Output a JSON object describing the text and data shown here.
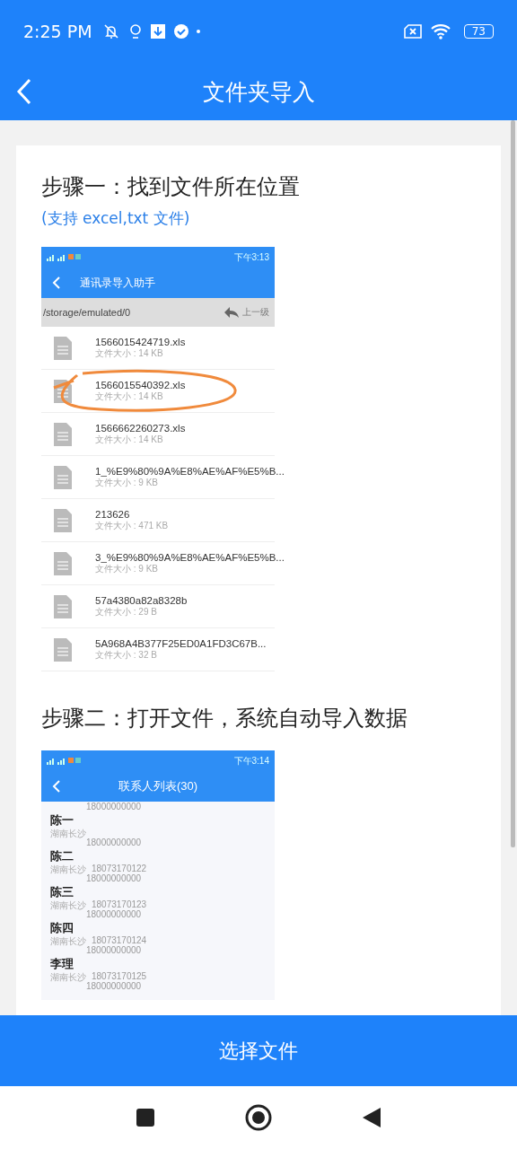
{
  "status_bar": {
    "time": "2:25 PM",
    "battery": "73"
  },
  "header": {
    "title": "文件夹导入"
  },
  "steps": [
    {
      "title": "步骤一：找到文件所在位置",
      "hint": "(支持 excel,txt 文件)",
      "kind": "files",
      "screen": {
        "status_time": "下午3:13",
        "title": "通讯录导入助手",
        "path": "/storage/emulated/0",
        "up_label": "上一级",
        "files": [
          {
            "name": "1566015424719.xls",
            "size": "文件大小 : 14 KB",
            "circled": false
          },
          {
            "name": "1566015540392.xls",
            "size": "文件大小 : 14 KB",
            "circled": true
          },
          {
            "name": "1566662260273.xls",
            "size": "文件大小 : 14 KB",
            "circled": false
          },
          {
            "name": "1_%E9%80%9A%E8%AE%AF%E5%B...",
            "size": "文件大小 : 9 KB",
            "circled": false
          },
          {
            "name": "213626",
            "size": "文件大小 : 471 KB",
            "circled": false
          },
          {
            "name": "3_%E9%80%9A%E8%AE%AF%E5%B...",
            "size": "文件大小 : 9 KB",
            "circled": false
          },
          {
            "name": "57a4380a82a8328b",
            "size": "文件大小 : 29 B",
            "circled": false
          },
          {
            "name": "5A968A4B377F25ED0A1FD3C67B...",
            "size": "文件大小 : 32 B",
            "circled": false
          }
        ]
      }
    },
    {
      "title": "步骤二：打开文件，系统自动导入数据",
      "kind": "contacts",
      "screen": {
        "status_time": "下午3:14",
        "title": "联系人列表(30)",
        "top_partial": "18000000000",
        "contacts": [
          {
            "name": "陈一",
            "city": "湖南长沙",
            "phone2": "18000000000"
          },
          {
            "name": "陈二",
            "city": "湖南长沙",
            "phone": "18073170122",
            "phone2": "18000000000"
          },
          {
            "name": "陈三",
            "city": "湖南长沙",
            "phone": "18073170123",
            "phone2": "18000000000"
          },
          {
            "name": "陈四",
            "city": "湖南长沙",
            "phone": "18073170124",
            "phone2": "18000000000"
          },
          {
            "name": "李理",
            "city": "湖南长沙",
            "phone": "18073170125",
            "phone2": "18000000000"
          }
        ]
      }
    }
  ],
  "bottom_button": "选择文件"
}
